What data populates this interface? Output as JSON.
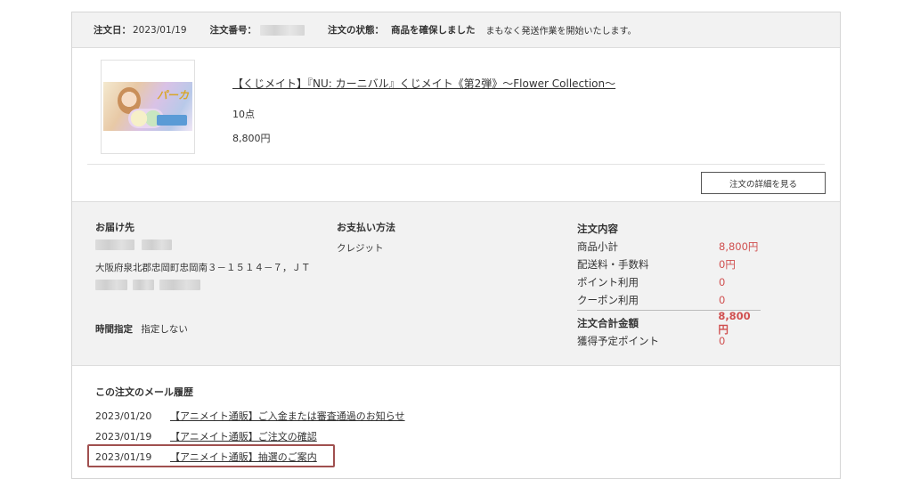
{
  "header": {
    "order_date_label": "注文日：",
    "order_date": "2023/01/19",
    "order_number_label": "注文番号：",
    "status_label": "注文の状態：",
    "status_value": "商品を確保しました",
    "status_note": "まもなく発送作業を開始いたします。"
  },
  "product": {
    "thumb_logo": "パーカ",
    "title": "【くじメイト】『NU: カーニバル』くじメイト《第2弾》～Flower Collection～",
    "quantity": "10点",
    "price": "8,800円"
  },
  "detail_button": "注文の詳細を見る",
  "shipping": {
    "heading": "お届け先",
    "address": "大阪府泉北郡忠岡町忠岡南３－１５１４－７，ＪＴ",
    "time_label": "時間指定",
    "time_value": "指定しない"
  },
  "payment": {
    "heading": "お支払い方法",
    "method": "クレジット"
  },
  "order_summary": {
    "heading": "注文内容",
    "rows": [
      {
        "label": "商品小計",
        "value": "8,800円"
      },
      {
        "label": "配送料・手数料",
        "value": "0円"
      },
      {
        "label": "ポイント利用",
        "value": "0"
      },
      {
        "label": "クーポン利用",
        "value": "0"
      }
    ],
    "total_label": "注文合計金額",
    "total_value": "8,800円",
    "points_label": "獲得予定ポイント",
    "points_value": "0"
  },
  "mail_history": {
    "heading": "この注文のメール履歴",
    "items": [
      {
        "date": "2023/01/20",
        "subject": "【アニメイト通販】ご入金または審査通過のお知らせ"
      },
      {
        "date": "2023/01/19",
        "subject": "【アニメイト通販】ご注文の確認"
      },
      {
        "date": "2023/01/19",
        "subject": "【アニメイト通販】抽選のご案内"
      }
    ]
  },
  "colors": {
    "price_red": "#d05050",
    "highlight_border": "#a0504f",
    "panel_gray": "#f2f2f2"
  }
}
